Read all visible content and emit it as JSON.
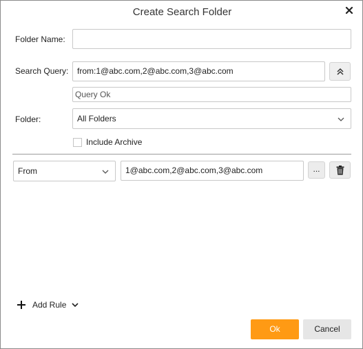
{
  "dialog": {
    "title": "Create Search Folder",
    "close_icon": "close-icon"
  },
  "form": {
    "folder_name_label": "Folder Name:",
    "folder_name_value": "",
    "search_query_label": "Search Query:",
    "search_query_value": "from:1@abc.com,2@abc.com,3@abc.com",
    "query_status": "Query Ok",
    "folder_label": "Folder:",
    "folder_value": "All Folders",
    "include_archive_label": "Include Archive",
    "include_archive_checked": false
  },
  "rule": {
    "field": "From",
    "value": "1@abc.com,2@abc.com,3@abc.com",
    "ellipsis_label": "..."
  },
  "footer": {
    "add_rule_label": "Add Rule",
    "ok_label": "Ok",
    "cancel_label": "Cancel"
  },
  "colors": {
    "accent": "#ff9a14",
    "cancel_bg": "#e6e6e6"
  }
}
